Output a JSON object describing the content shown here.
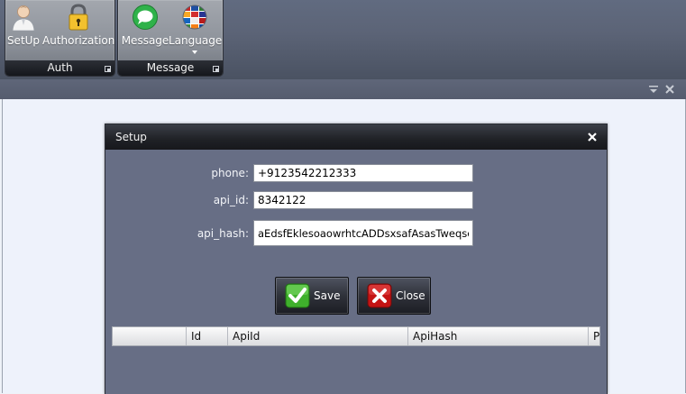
{
  "ribbon": {
    "groups": [
      {
        "label": "Auth",
        "buttons": [
          {
            "label": "SetUp",
            "icon": "user-icon"
          },
          {
            "label": "Authorization",
            "icon": "lock-icon"
          }
        ]
      },
      {
        "label": "Message",
        "buttons": [
          {
            "label": "Message",
            "icon": "chat-bubble-icon"
          },
          {
            "label": "Language",
            "icon": "globe-flags-icon"
          }
        ]
      }
    ]
  },
  "dialog": {
    "title": "Setup",
    "fields": {
      "phone": {
        "label": "phone:",
        "value": "+9123542212333"
      },
      "api_id": {
        "label": "api_id:",
        "value": "8342122"
      },
      "api_hash": {
        "label": "api_hash:",
        "value": "aEdsfEklesoaowrhtcADDsxsafAsasTweqscw"
      }
    },
    "buttons": {
      "save": "Save",
      "close": "Close"
    },
    "grid": {
      "columns": [
        "",
        "Id",
        "ApiId",
        "ApiHash",
        "Ph"
      ]
    }
  },
  "colors": {
    "ribbon_bg": "#5c6477",
    "dialog_bg": "#676e85",
    "workspace_bg": "#eef2fb",
    "save_green": "#3fb02c",
    "close_red": "#c41414"
  }
}
